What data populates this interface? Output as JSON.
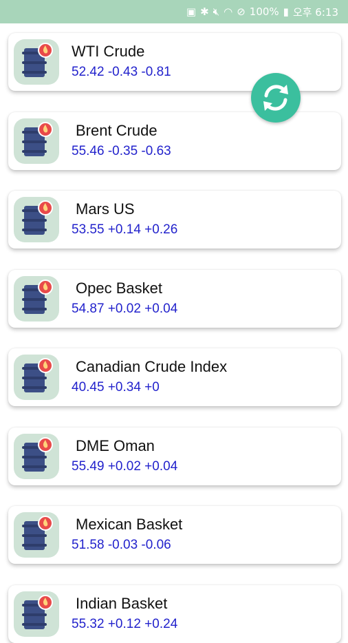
{
  "status_bar": {
    "battery": "100%",
    "time": "오후 6:13"
  },
  "items": [
    {
      "name": "WTI Crude",
      "values": "52.42 -0.43 -0.81",
      "icon": "oil-barrel-icon"
    },
    {
      "name": "Brent Crude",
      "values": "55.46 -0.35 -0.63",
      "icon": "oil-barrel-icon"
    },
    {
      "name": "Mars US",
      "values": "53.55 +0.14 +0.26",
      "icon": "oil-barrel-icon"
    },
    {
      "name": "Opec Basket",
      "values": "54.87 +0.02 +0.04",
      "icon": "oil-barrel-icon"
    },
    {
      "name": "Canadian Crude Index",
      "values": "40.45 +0.34 +0",
      "icon": "oil-barrel-icon"
    },
    {
      "name": "DME Oman",
      "values": "55.49 +0.02 +0.04",
      "icon": "oil-barrel-icon"
    },
    {
      "name": "Mexican Basket",
      "values": "51.58 -0.03 -0.06",
      "icon": "oil-barrel-icon"
    },
    {
      "name": "Indian Basket",
      "values": "55.32 +0.12 +0.24",
      "icon": "oil-barrel-icon"
    }
  ],
  "refresh_button": {
    "icon": "refresh-icon"
  },
  "colors": {
    "status_bar": "#a8d5ba",
    "value_text": "#2222cc",
    "refresh": "#3bbf9e",
    "barrel": "#3c4f86",
    "flame_badge": "#e84a4a",
    "thumb_bg": "#cfe3d6"
  }
}
